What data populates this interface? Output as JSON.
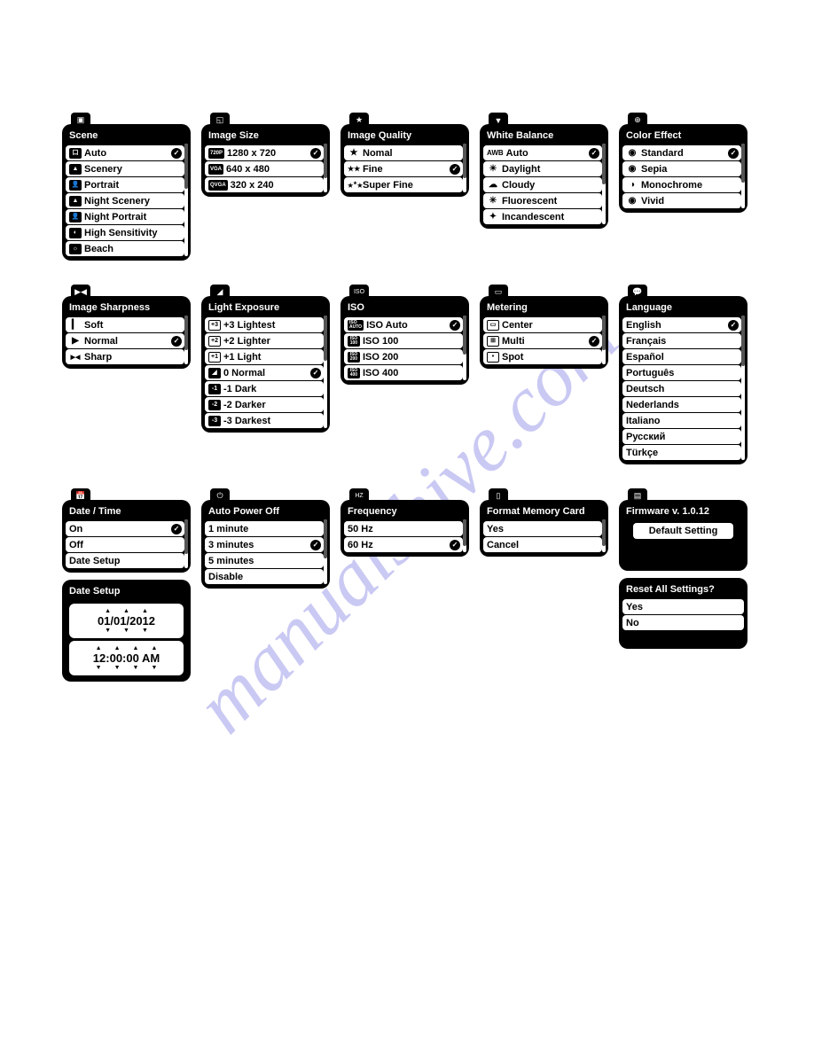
{
  "watermark": "manualshive.com",
  "menus": {
    "scene": {
      "title": "Scene",
      "items": [
        {
          "label": "Auto",
          "selected": true,
          "icon_box": "口"
        },
        {
          "label": "Scenery",
          "icon_box": "▲"
        },
        {
          "label": "Portrait",
          "icon_box": "👤"
        },
        {
          "label": "Night Scenery",
          "icon_box": "▲"
        },
        {
          "label": "Night Portrait",
          "icon_box": "👤"
        },
        {
          "label": "High Sensitivity",
          "icon_box": "◐"
        },
        {
          "label": "Beach",
          "icon_box": "☼"
        }
      ]
    },
    "image_size": {
      "title": "Image Size",
      "items": [
        {
          "prefix": "720P",
          "label": "1280 x 720",
          "selected": true
        },
        {
          "prefix": "VGA",
          "label": "640 x 480"
        },
        {
          "prefix": "QVGA",
          "label": "320 x 240"
        }
      ]
    },
    "image_quality": {
      "title": "Image Quality",
      "items": [
        {
          "sym": "★",
          "label": "Nomal"
        },
        {
          "sym": "★★",
          "label": "Fine",
          "selected": true
        },
        {
          "sym": "★★",
          "sup": "★",
          "label": "Super Fine"
        }
      ]
    },
    "white_balance": {
      "title": "White Balance",
      "items": [
        {
          "prefix": "AWB",
          "label": "Auto",
          "selected": true
        },
        {
          "sym": "☀",
          "label": "Daylight"
        },
        {
          "sym": "☁",
          "label": "Cloudy"
        },
        {
          "sym": "✳",
          "label": "Fluorescent"
        },
        {
          "sym": "✦",
          "label": "Incandescent"
        }
      ]
    },
    "color_effect": {
      "title": "Color Effect",
      "items": [
        {
          "sym": "◉",
          "label": "Standard",
          "selected": true
        },
        {
          "sym": "◉",
          "label": "Sepia"
        },
        {
          "sym": "◑",
          "label": "Monochrome"
        },
        {
          "sym": "◉",
          "label": "Vivid"
        }
      ]
    },
    "image_sharpness": {
      "title": "Image Sharpness",
      "items": [
        {
          "sym": "▎",
          "label": "Soft"
        },
        {
          "sym": "▶",
          "label": "Normal",
          "selected": true
        },
        {
          "sym": "▶◀",
          "label": "Sharp"
        }
      ]
    },
    "light_exposure": {
      "title": "Light Exposure",
      "items": [
        {
          "icon_box_inv": "+3",
          "label": "+3 Lightest"
        },
        {
          "icon_box_inv": "+2",
          "label": "+2 Lighter"
        },
        {
          "icon_box_inv": "+1",
          "label": "+1 Light"
        },
        {
          "icon_box": "◢",
          "label": "0 Normal",
          "selected": true
        },
        {
          "icon_box": "-1",
          "label": "-1 Dark"
        },
        {
          "icon_box": "-2",
          "label": "-2 Darker"
        },
        {
          "icon_box": "-3",
          "label": "-3 Darkest"
        }
      ]
    },
    "iso": {
      "title": "ISO",
      "items": [
        {
          "icon_box": "ISO\nAUTO",
          "label": "ISO Auto",
          "selected": true
        },
        {
          "icon_box": "ISO\n100",
          "label": "ISO 100"
        },
        {
          "icon_box": "ISO\n200",
          "label": "ISO 200"
        },
        {
          "icon_box": "ISO\n400",
          "label": "ISO 400"
        }
      ]
    },
    "metering": {
      "title": "Metering",
      "items": [
        {
          "icon_box_inv": "▭",
          "label": "Center"
        },
        {
          "icon_box_inv": "⊞",
          "label": "Multi",
          "selected": true
        },
        {
          "icon_box_inv": "•",
          "label": "Spot"
        }
      ]
    },
    "language": {
      "title": "Language",
      "items": [
        {
          "label": "English",
          "selected": true
        },
        {
          "label": "Français"
        },
        {
          "label": "Español"
        },
        {
          "label": "Português"
        },
        {
          "label": "Deutsch"
        },
        {
          "label": "Nederlands"
        },
        {
          "label": "Italiano"
        },
        {
          "label": "Русский"
        },
        {
          "label": "Türkçe"
        }
      ]
    },
    "date_time": {
      "title": "Date / Time",
      "items": [
        {
          "label": "On",
          "selected": true
        },
        {
          "label": "Off"
        },
        {
          "label": "Date Setup"
        }
      ]
    },
    "date_setup": {
      "title": "Date Setup",
      "date": "01/01/2012",
      "time": "12:00:00 AM"
    },
    "auto_power_off": {
      "title": "Auto Power Off",
      "items": [
        {
          "label": "1 minute"
        },
        {
          "label": "3 minutes",
          "selected": true
        },
        {
          "label": "5 minutes"
        },
        {
          "label": "Disable"
        }
      ]
    },
    "frequency": {
      "title": "Frequency",
      "items": [
        {
          "label": "50 Hz"
        },
        {
          "label": "60 Hz",
          "selected": true
        }
      ]
    },
    "format_memory": {
      "title": "Format Memory Card",
      "items": [
        {
          "label": "Yes"
        },
        {
          "label": "Cancel"
        }
      ]
    },
    "firmware": {
      "title": "Firmware v. 1.0.12",
      "button": "Default Setting"
    },
    "reset": {
      "title": "Reset All Settings?",
      "items": [
        {
          "label": "Yes"
        },
        {
          "label": "No"
        }
      ]
    }
  }
}
